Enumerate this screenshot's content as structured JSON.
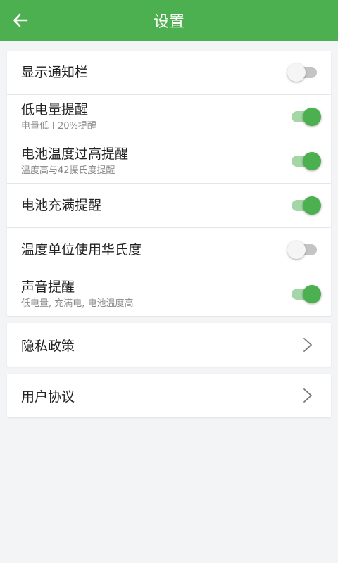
{
  "header": {
    "title": "设置"
  },
  "settings": [
    {
      "label": "显示通知栏",
      "sub": "",
      "on": false
    },
    {
      "label": "低电量提醒",
      "sub": "电量低于20%提醒",
      "on": true
    },
    {
      "label": "电池温度过高提醒",
      "sub": "温度高与42摄氏度提醒",
      "on": true
    },
    {
      "label": "电池充满提醒",
      "sub": "",
      "on": true
    },
    {
      "label": "温度单位使用华氏度",
      "sub": "",
      "on": false
    },
    {
      "label": "声音提醒",
      "sub": "低电量, 充满电, 电池温度高",
      "on": true
    }
  ],
  "links": [
    {
      "label": "隐私政策"
    },
    {
      "label": "用户协议"
    }
  ],
  "colors": {
    "accent": "#4caf50",
    "accent_light": "#a5d6a7",
    "background": "#f3f4f6"
  }
}
